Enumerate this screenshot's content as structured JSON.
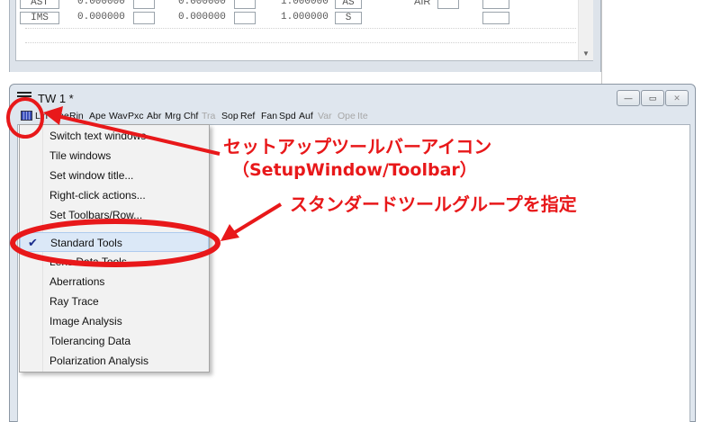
{
  "top_window": {
    "rows": [
      {
        "label": "AST",
        "v1": "0.000000",
        "v2": "0.000000",
        "v3": "1.000000",
        "code": "AS",
        "extra": "AIR"
      },
      {
        "label": "IMS",
        "v1": "0.000000",
        "v2": "0.000000",
        "v3": "1.000000",
        "code": "S",
        "extra": ""
      }
    ]
  },
  "tw_window": {
    "title": "TW 1 *",
    "buttons": {
      "minimize": "—",
      "maximize": "▭",
      "close": "✕"
    },
    "toolbar_items": [
      {
        "label": "Lin",
        "enabled": true
      },
      {
        "label": "Ape",
        "enabled": true
      },
      {
        "label": "Rin",
        "enabled": true
      },
      {
        "label": "Ape",
        "enabled": true
      },
      {
        "label": "Wav",
        "enabled": true
      },
      {
        "label": "Pxc",
        "enabled": true
      },
      {
        "label": "Abr",
        "enabled": true
      },
      {
        "label": "Mrg",
        "enabled": true
      },
      {
        "label": "Chf",
        "enabled": true
      },
      {
        "label": "Tra",
        "enabled": false
      },
      {
        "label": "Sop",
        "enabled": true
      },
      {
        "label": "Ref",
        "enabled": true
      },
      {
        "label": "Fan",
        "enabled": true
      },
      {
        "label": "Spd",
        "enabled": true
      },
      {
        "label": "Auf",
        "enabled": true
      },
      {
        "label": "Var",
        "enabled": false
      },
      {
        "label": "Ope",
        "enabled": false
      },
      {
        "label": "Ite",
        "enabled": false
      }
    ]
  },
  "popup_menu": {
    "items": [
      {
        "label": "Switch text windows",
        "checked": false
      },
      {
        "label": "Tile windows",
        "checked": false
      },
      {
        "label": "Set window title...",
        "checked": false
      },
      {
        "label": "Right-click actions...",
        "checked": false
      },
      {
        "label": "Set Toolbars/Row...",
        "checked": false
      },
      {
        "label": "Standard Tools",
        "checked": true
      },
      {
        "label": "Lens Data Tools",
        "checked": false
      },
      {
        "label": "Aberrations",
        "checked": false
      },
      {
        "label": "Ray Trace",
        "checked": false
      },
      {
        "label": "Image Analysis",
        "checked": false
      },
      {
        "label": "Tolerancing Data",
        "checked": false
      },
      {
        "label": "Polarization Analysis",
        "checked": false
      }
    ],
    "checkmark": "✔"
  },
  "annotations": {
    "callout_1_line1": "セットアップツールバーアイコン",
    "callout_1_line2": "（SetupWindow/Toolbar）",
    "callout_2": "スタンダードツールグループを指定",
    "color": "#e8181a"
  }
}
